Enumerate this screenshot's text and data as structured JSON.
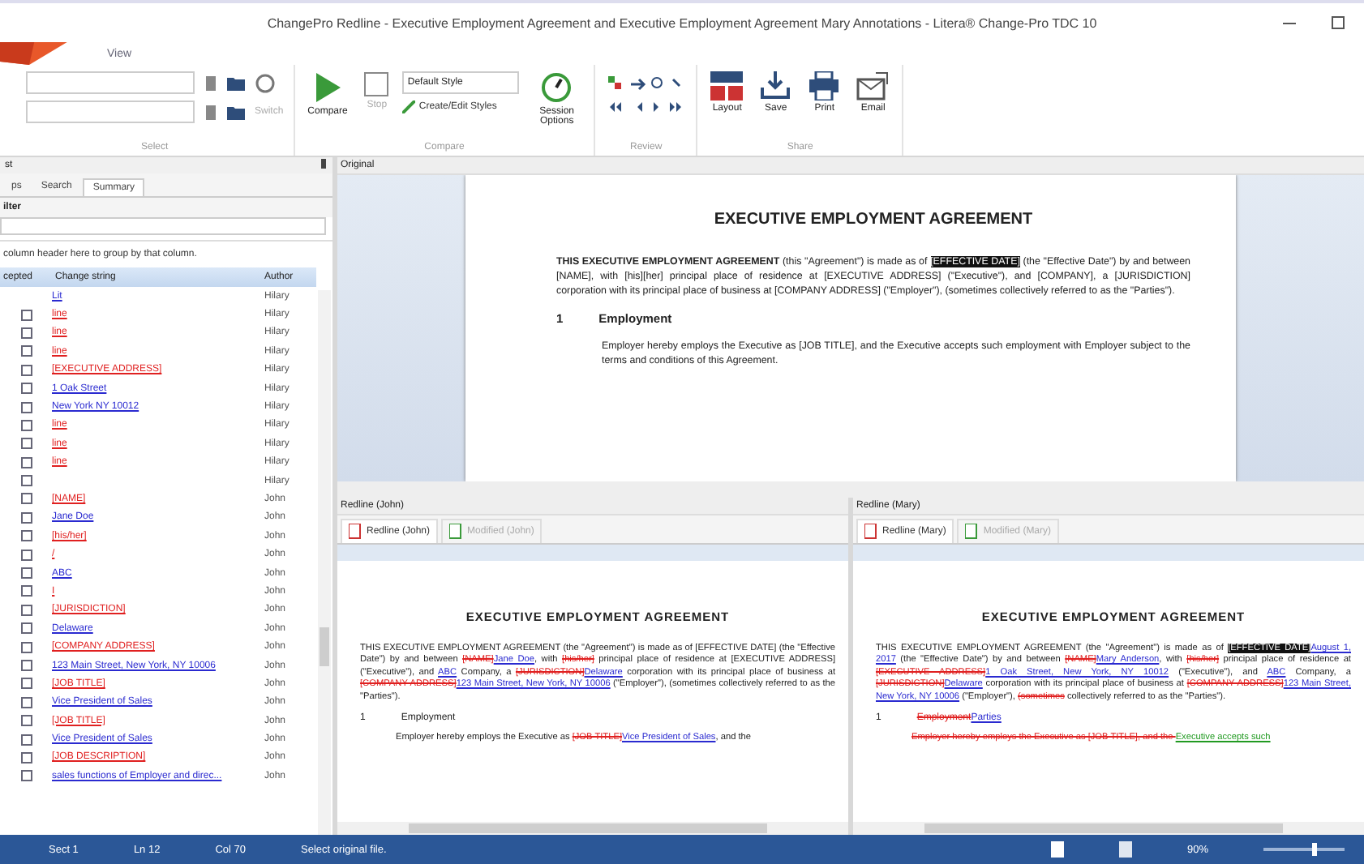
{
  "window": {
    "title": "ChangePro Redline - Executive Employment Agreement and Executive Employment Agreement Mary Annotations - Litera® Change-Pro TDC 10"
  },
  "menu": [
    {
      "label": "View",
      "selected": false
    }
  ],
  "ribbon": {
    "groups": [
      {
        "kind": "select",
        "label": "Select",
        "switch": "Switch"
      },
      {
        "kind": "compare",
        "label": "Compare",
        "compare": "Compare",
        "stop": "Stop",
        "style": "Default Style",
        "styles_link": "Create/Edit Styles",
        "session": "Session Options"
      },
      {
        "kind": "review",
        "label": "Review"
      },
      {
        "kind": "share",
        "label": "Share",
        "buttons": [
          "Layout",
          "Save",
          "Print",
          "Email"
        ]
      }
    ]
  },
  "changes_panel": {
    "title": "st",
    "tabs": [
      {
        "label": "ps",
        "selected": false
      },
      {
        "label": "Search",
        "selected": false
      },
      {
        "label": "Summary",
        "selected": true
      }
    ],
    "filter_label": "ilter",
    "group_hint": "column header here to group by that column.",
    "columns": [
      "cepted",
      "Change string",
      "Author"
    ],
    "rows": [
      {
        "text": "Lit",
        "kind": "ins",
        "author": "Hilary"
      },
      {
        "text": "line",
        "kind": "del",
        "author": "Hilary",
        "checked": false
      },
      {
        "text": "line",
        "kind": "del",
        "author": "Hilary",
        "checked": false
      },
      {
        "text": "line",
        "kind": "del",
        "author": "Hilary",
        "checked": false
      },
      {
        "text": "[EXECUTIVE ADDRESS]",
        "kind": "del",
        "author": "Hilary",
        "checked": false
      },
      {
        "text": "1 Oak Street",
        "kind": "ins",
        "author": "Hilary",
        "checked": false
      },
      {
        "text": "New York NY 10012",
        "kind": "ins",
        "author": "Hilary",
        "checked": false
      },
      {
        "text": "line",
        "kind": "del",
        "author": "Hilary",
        "checked": false
      },
      {
        "text": "line",
        "kind": "del",
        "author": "Hilary",
        "checked": false
      },
      {
        "text": "line",
        "kind": "del",
        "author": "Hilary",
        "checked": false
      },
      {
        "author": "Hilary",
        "checked": false
      },
      {
        "text": "[NAME]",
        "kind": "del",
        "author": "John",
        "checked": false
      },
      {
        "text": "Jane Doe",
        "kind": "ins",
        "author": "John",
        "checked": false
      },
      {
        "text": "[his/her]",
        "kind": "del",
        "author": "John",
        "checked": false
      },
      {
        "text": "/",
        "kind": "del",
        "author": "John",
        "checked": false
      },
      {
        "text": "ABC",
        "kind": "ins",
        "author": "John",
        "checked": false
      },
      {
        "text": "I",
        "kind": "del",
        "author": "John",
        "checked": false
      },
      {
        "text": "[JURISDICTION]",
        "kind": "del",
        "author": "John",
        "checked": false
      },
      {
        "text": "Delaware",
        "kind": "ins",
        "author": "John",
        "checked": false
      },
      {
        "text": "[COMPANY ADDRESS]",
        "kind": "del",
        "author": "John",
        "checked": false
      },
      {
        "text": "123 Main Street, New York, NY 10006",
        "kind": "ins",
        "author": "John",
        "checked": false
      },
      {
        "text": "[JOB TITLE]",
        "kind": "del",
        "author": "John",
        "checked": false
      },
      {
        "text": "Vice President of Sales",
        "kind": "ins",
        "author": "John",
        "checked": false
      },
      {
        "text": "[JOB TITLE]",
        "kind": "del",
        "author": "John",
        "checked": false
      },
      {
        "text": "Vice President of Sales",
        "kind": "ins",
        "author": "John",
        "checked": false
      },
      {
        "text": "[JOB DESCRIPTION]",
        "kind": "del",
        "author": "John",
        "checked": false
      },
      {
        "text": "sales functions of Employer and direc...",
        "kind": "ins",
        "author": "John",
        "checked": false
      }
    ]
  },
  "original": {
    "title": "Original",
    "doc_title": "EXECUTIVE EMPLOYMENT AGREEMENT",
    "paragraphs": [
      [
        {
          "kind": "bold",
          "text": "THIS EXECUTIVE EMPLOYMENT AGREEMENT"
        },
        {
          "kind": "plain",
          "text": " (this \"Agreement\") is made as of "
        },
        {
          "kind": "mark",
          "text": "[EFFECTIVE DATE]"
        },
        {
          "kind": "plain",
          "text": " (the \"Effective Date\") by and between [NAME], with [his][her] principal place of residence at [EXECUTIVE ADDRESS] (\"Executive\"), and [COMPANY], a [JURISDICTION] corporation with its principal place of business at [COMPANY ADDRESS] (\"Employer\"), (sometimes collectively referred to as the \"Parties\")."
        }
      ]
    ],
    "section_number": "1",
    "section_title": "Employment",
    "section_text": "Employer hereby employs the Executive as [JOB TITLE], and the Executive accepts such employment with Employer subject to the terms and conditions of this Agreement."
  },
  "redlines": [
    {
      "title": "Redline (John)",
      "tabs": [
        {
          "label": "Redline (John)",
          "selected": true
        },
        {
          "label": "Modified (John)",
          "selected": false
        }
      ],
      "doc_title": "EXECUTIVE EMPLOYMENT AGREEMENT",
      "paragraphs": [
        [
          {
            "kind": "plain",
            "text": "THIS EXECUTIVE EMPLOYMENT AGREEMENT (the \"Agreement\") is made as of [EFFECTIVE DATE] (the \"Effective Date\") by and between "
          },
          {
            "kind": "del",
            "text": "[NAME]"
          },
          {
            "kind": "ins",
            "text": "Jane Doe"
          },
          {
            "kind": "plain",
            "text": ", with "
          },
          {
            "kind": "del",
            "text": "[his/her]"
          },
          {
            "kind": "plain",
            "text": " principal place of residence at [EXECUTIVE ADDRESS] (\"Executive\"), and "
          },
          {
            "kind": "ins",
            "text": "ABC"
          },
          {
            "kind": "plain",
            "text": " Company, a "
          },
          {
            "kind": "del",
            "text": "[JURISDICTION]"
          },
          {
            "kind": "ins",
            "text": "Delaware"
          },
          {
            "kind": "plain",
            "text": " corporation with its principal place of business at "
          },
          {
            "kind": "del",
            "text": "[COMPANY ADDRESS]"
          },
          {
            "kind": "ins",
            "text": "123 Main Street, New York, NY 10006"
          },
          {
            "kind": "plain",
            "text": " (\"Employer\"), (sometimes collectively referred to as the \"Parties\")."
          }
        ]
      ],
      "section_number": "1",
      "section_title": [
        {
          "kind": "plain",
          "text": "Employment"
        }
      ],
      "section_text": [
        {
          "kind": "plain",
          "text": "Employer hereby employs the Executive as "
        },
        {
          "kind": "del",
          "text": "[JOB TITLE]"
        },
        {
          "kind": "ins",
          "text": "Vice President of Sales"
        },
        {
          "kind": "plain",
          "text": ", and the"
        }
      ]
    },
    {
      "title": "Redline (Mary)",
      "tabs": [
        {
          "label": "Redline (Mary)",
          "selected": true
        },
        {
          "label": "Modified (Mary)",
          "selected": false
        }
      ],
      "doc_title": "EXECUTIVE EMPLOYMENT AGREEMENT",
      "paragraphs": [
        [
          {
            "kind": "plain",
            "text": "THIS EXECUTIVE EMPLOYMENT AGREEMENT (the \"Agreement\") is made as of "
          },
          {
            "kind": "mark",
            "text": "[EFFECTIVE DATE]"
          },
          {
            "kind": "ins",
            "text": "August 1, 2017"
          },
          {
            "kind": "plain",
            "text": " (the \"Effective Date\") by and between "
          },
          {
            "kind": "del",
            "text": "[NAME]"
          },
          {
            "kind": "ins",
            "text": "Mary Anderson"
          },
          {
            "kind": "plain",
            "text": ", with "
          },
          {
            "kind": "del",
            "text": "[his/her]"
          },
          {
            "kind": "plain",
            "text": " principal place of residence at "
          },
          {
            "kind": "del",
            "text": "[EXECUTIVE ADDRESS]"
          },
          {
            "kind": "ins",
            "text": "1 Oak Street, New York, NY 10012"
          },
          {
            "kind": "plain",
            "text": " (\"Executive\"), and "
          },
          {
            "kind": "ins",
            "text": "ABC"
          },
          {
            "kind": "plain",
            "text": " Company, a "
          },
          {
            "kind": "del",
            "text": "[JURISDICTION]"
          },
          {
            "kind": "ins",
            "text": "Delaware"
          },
          {
            "kind": "plain",
            "text": " corporation with its principal place of business at "
          },
          {
            "kind": "del",
            "text": "[COMPANY ADDRESS]"
          },
          {
            "kind": "ins",
            "text": "123 Main Street, New York, NY 10006"
          },
          {
            "kind": "plain",
            "text": " (\"Employer\"), "
          },
          {
            "kind": "del",
            "text": "(sometimes"
          },
          {
            "kind": "plain",
            "text": " collectively referred to as the \"Parties\")."
          }
        ]
      ],
      "section_number": "1",
      "section_title": [
        {
          "kind": "del",
          "text": "Employment"
        },
        {
          "kind": "ins",
          "text": "Parties"
        }
      ],
      "section_text": [
        {
          "kind": "del",
          "text": "Employer hereby employs the Executive as [JOB TITLE], and the "
        },
        {
          "kind": "moved",
          "text": "Executive accepts such"
        }
      ]
    }
  ],
  "status_bar": {
    "items": [
      "Sect 1",
      "Ln 12",
      "Col 70",
      "Select original file."
    ],
    "zoom": "90%",
    "level": 0.6
  }
}
